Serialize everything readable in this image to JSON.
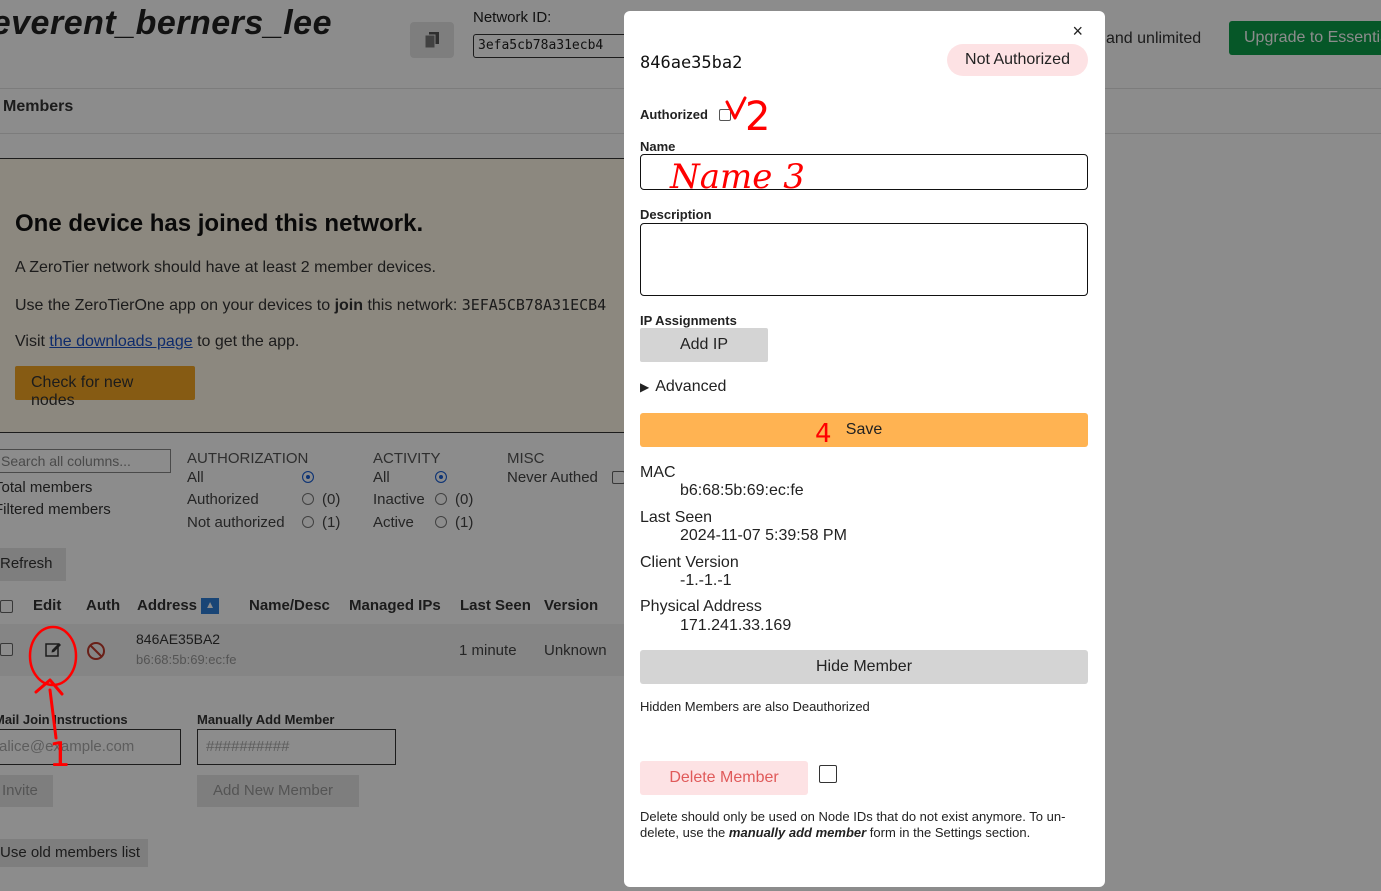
{
  "network": {
    "name": "reverent_berners_lee",
    "id_label": "Network ID:",
    "id_value": "3efa5cb78a31ecb4",
    "plan_text": "and unlimited",
    "upgrade_label": "Upgrade to Essentials"
  },
  "tabs": {
    "members": "Members"
  },
  "join": {
    "title": "One device has joined this network.",
    "line1": "A ZeroTier network should have at least 2 member devices.",
    "line2_pre": "Use the ZeroTierOne app on your devices to ",
    "line2_bold": "join",
    "line2_post": " this network: ",
    "line2_id": "3EFA5CB78A31ECB4",
    "line3_pre": "Visit ",
    "line3_link": "the downloads page",
    "line3_post": " to get the app.",
    "check_button": "Check for new nodes"
  },
  "filters": {
    "search_placeholder": "Search all columns...",
    "total_members": "Total members",
    "filtered_members": "Filtered members",
    "authorization": {
      "head": "AUTHORIZATION",
      "all": "All",
      "authorized": "Authorized",
      "authorized_count": "(0)",
      "not_authorized": "Not authorized",
      "not_authorized_count": "(1)"
    },
    "activity": {
      "head": "ACTIVITY",
      "all": "All",
      "inactive": "Inactive",
      "inactive_count": "(0)",
      "active": "Active",
      "active_count": "(1)"
    },
    "misc": {
      "head": "MISC",
      "never_authed": "Never Authed"
    },
    "refresh": "Refresh"
  },
  "table": {
    "headers": {
      "edit": "Edit",
      "auth": "Auth",
      "address": "Address",
      "name": "Name/Desc",
      "ips": "Managed IPs",
      "last_seen": "Last Seen",
      "version": "Version"
    },
    "row": {
      "address": "846AE35BA2",
      "mac": "b6:68:5b:69:ec:fe",
      "last_seen": "1 minute",
      "version": "Unknown"
    }
  },
  "invite": {
    "mail_label": "Mail Join Instructions",
    "mail_placeholder": "alice@example.com",
    "manual_label": "Manually Add Member",
    "manual_placeholder": "##########",
    "invite_button": "Invite",
    "add_button": "Add New Member",
    "old_list": "Use old members list"
  },
  "modal": {
    "close": "×",
    "member_id": "846ae35ba2",
    "status_badge": "Not Authorized",
    "authorized_label": "Authorized",
    "name_label": "Name",
    "name_value": "",
    "description_label": "Description",
    "description_value": "",
    "ip_label": "IP Assignments",
    "add_ip": "Add IP",
    "advanced": "Advanced",
    "save": "Save",
    "info": [
      {
        "key": "MAC",
        "value": "b6:68:5b:69:ec:fe"
      },
      {
        "key": "Last Seen",
        "value": "2024-11-07 5:39:58 PM"
      },
      {
        "key": "Client Version",
        "value": "-1.-1.-1"
      },
      {
        "key": "Physical Address",
        "value": "171.241.33.169"
      }
    ],
    "hide_member": "Hide Member",
    "hide_note": "Hidden Members are also Deauthorized",
    "delete_member": "Delete Member",
    "delete_note_pre": "Delete should only be used on Node IDs that do not exist anymore. To un-delete, use the ",
    "delete_note_em": "manually add member",
    "delete_note_post": " form in the Settings section."
  },
  "annotations": {
    "step1": "1",
    "step2": "2",
    "step3_text": "Name 3",
    "step4": "4"
  },
  "colors": {
    "save": "#ffb352",
    "badge_bg": "#fde2e4",
    "annotation": "#ff0000",
    "upgrade": "#0b9e4a",
    "check_nodes": "#f5a623"
  }
}
